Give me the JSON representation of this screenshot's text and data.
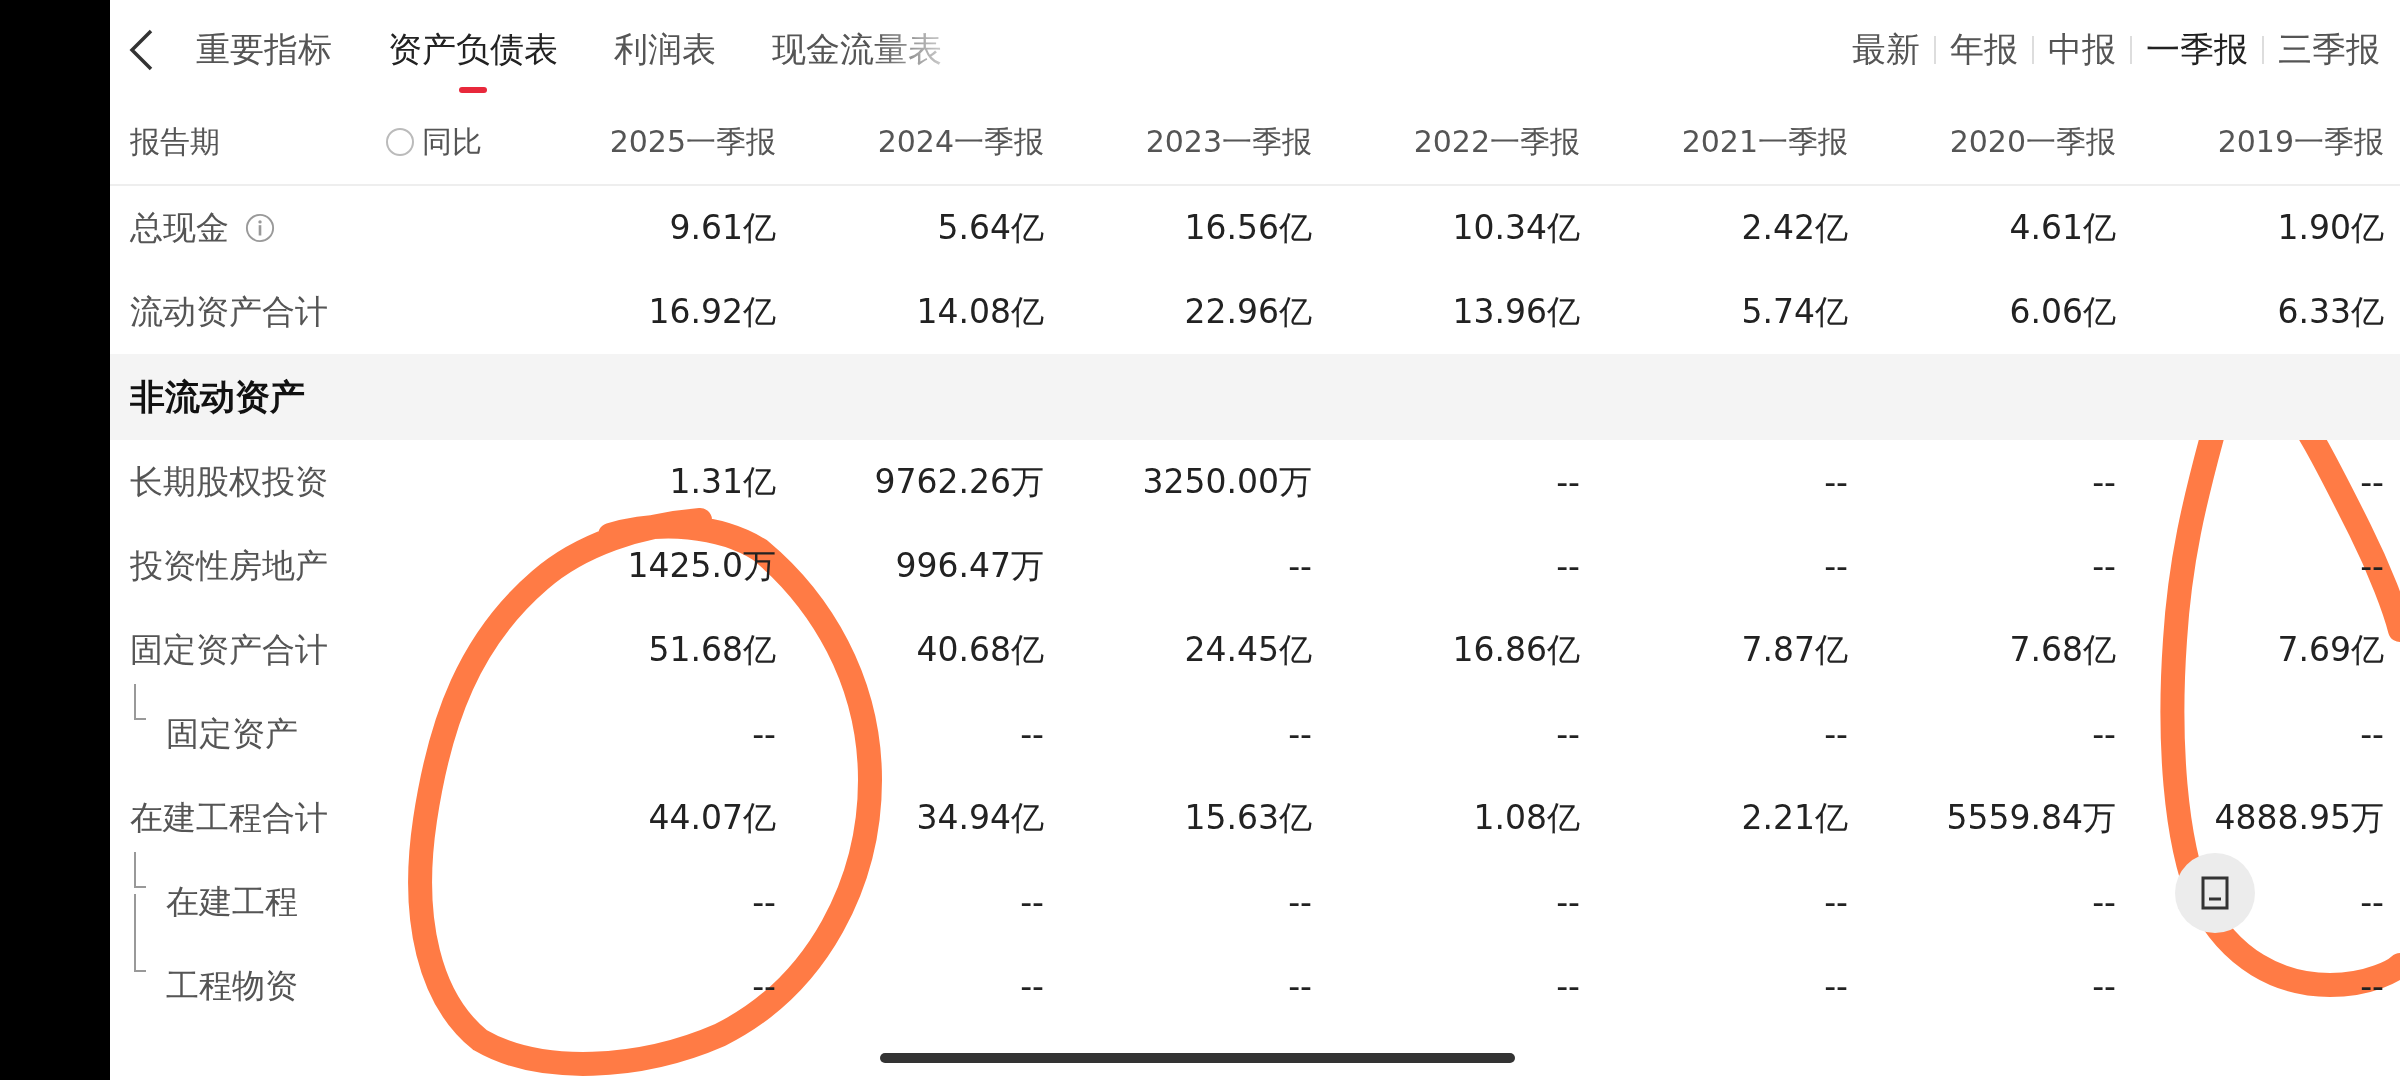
{
  "nav": {
    "tabs": [
      {
        "label": "重要指标",
        "selected": false
      },
      {
        "label": "资产负债表",
        "selected": true
      },
      {
        "label": "利润表",
        "selected": false
      },
      {
        "label": "现金流量表",
        "selected": false
      }
    ]
  },
  "periods": [
    {
      "label": "最新",
      "selected": false
    },
    {
      "label": "年报",
      "selected": false
    },
    {
      "label": "中报",
      "selected": false
    },
    {
      "label": "一季报",
      "selected": true
    },
    {
      "label": "三季报",
      "selected": false
    }
  ],
  "table": {
    "header": {
      "label": "报告期",
      "yoy": {
        "label": "同比",
        "checked": false
      },
      "columns": [
        "2025一季报",
        "2024一季报",
        "2023一季报",
        "2022一季报",
        "2021一季报",
        "2020一季报",
        "2019一季报"
      ]
    },
    "rows": [
      {
        "kind": "row",
        "label": "总现金",
        "info": true,
        "values": [
          "9.61亿",
          "5.64亿",
          "16.56亿",
          "10.34亿",
          "2.42亿",
          "4.61亿",
          "1.90亿"
        ]
      },
      {
        "kind": "row",
        "label": "流动资产合计",
        "values": [
          "16.92亿",
          "14.08亿",
          "22.96亿",
          "13.96亿",
          "5.74亿",
          "6.06亿",
          "6.33亿"
        ]
      },
      {
        "kind": "section",
        "label": "非流动资产"
      },
      {
        "kind": "row",
        "label": "长期股权投资",
        "values": [
          "1.31亿",
          "9762.26万",
          "3250.00万",
          "--",
          "--",
          "--",
          "--"
        ]
      },
      {
        "kind": "row",
        "label": "投资性房地产",
        "values": [
          "1425.0万",
          "996.47万",
          "--",
          "--",
          "--",
          "--",
          "--"
        ]
      },
      {
        "kind": "row",
        "label": "固定资产合计",
        "values": [
          "51.68亿",
          "40.68亿",
          "24.45亿",
          "16.86亿",
          "7.87亿",
          "7.68亿",
          "7.69亿"
        ]
      },
      {
        "kind": "child",
        "label": "固定资产",
        "values": [
          "--",
          "--",
          "--",
          "--",
          "--",
          "--",
          "--"
        ]
      },
      {
        "kind": "row",
        "label": "在建工程合计",
        "values": [
          "44.07亿",
          "34.94亿",
          "15.63亿",
          "1.08亿",
          "2.21亿",
          "5559.84万",
          "4888.95万"
        ]
      },
      {
        "kind": "child",
        "label": "在建工程",
        "values": [
          "--",
          "--",
          "--",
          "--",
          "--",
          "--",
          "--"
        ]
      },
      {
        "kind": "child",
        "label": "工程物资",
        "values": [
          "--",
          "--",
          "--",
          "--",
          "--",
          "--",
          "--"
        ]
      }
    ]
  }
}
